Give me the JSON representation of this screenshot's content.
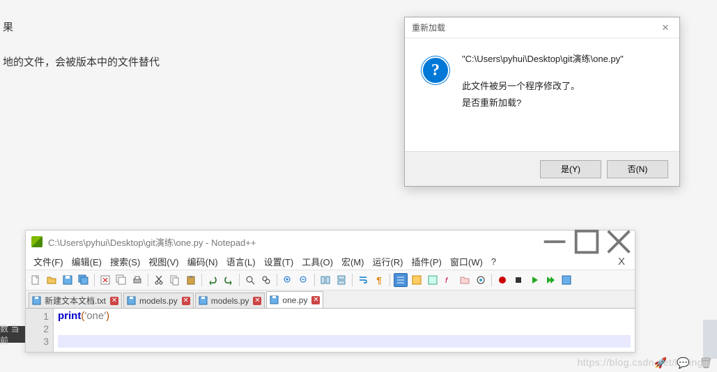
{
  "bg": {
    "line1": "果",
    "line2": "地的文件，会被版本中的文件替代",
    "leftstrip": "数 当前"
  },
  "dialog": {
    "title": "重新加载",
    "path": "\"C:\\Users\\pyhui\\Desktop\\git演练\\one.py\"",
    "line1": "此文件被另一个程序修改了。",
    "line2": "是否重新加载?",
    "yes": "是(Y)",
    "no": "否(N)"
  },
  "npp": {
    "title": "C:\\Users\\pyhui\\Desktop\\git演练\\one.py - Notepad++",
    "menus": [
      "文件(F)",
      "编辑(E)",
      "搜索(S)",
      "视图(V)",
      "编码(N)",
      "语言(L)",
      "设置(T)",
      "工具(O)",
      "宏(M)",
      "运行(R)",
      "插件(P)",
      "窗口(W)",
      "?"
    ],
    "tabs": [
      {
        "label": "新建文本文档.txt",
        "active": false
      },
      {
        "label": "models.py",
        "active": false
      },
      {
        "label": "models.py",
        "active": false
      },
      {
        "label": "one.py",
        "active": true
      }
    ],
    "gutter": [
      "1",
      "2",
      "3"
    ],
    "code": {
      "kw": "print",
      "paren_open": "(",
      "str": "'one'",
      "paren_close": ")"
    }
  },
  "watermark": "https://blog.csdn.net/lubing"
}
